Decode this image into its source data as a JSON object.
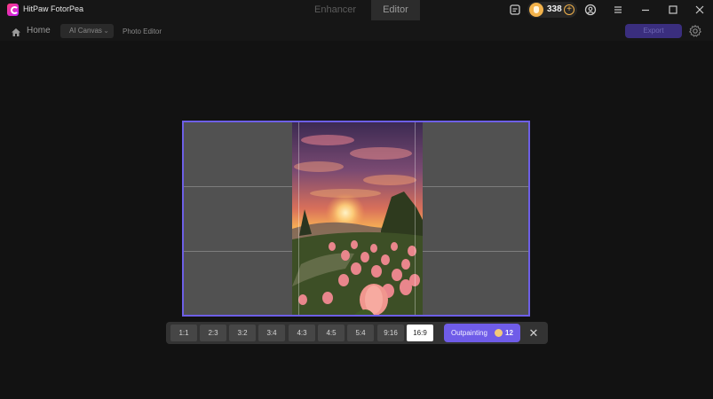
{
  "app": {
    "title": "HitPaw FotorPea"
  },
  "mode_tabs": [
    {
      "label": "Enhancer",
      "active": false
    },
    {
      "label": "Editor",
      "active": true
    }
  ],
  "titlebar": {
    "credits": "338",
    "icons": [
      "announcement-icon",
      "coin-icon",
      "add-credits-icon",
      "account-icon",
      "menu-icon",
      "minimize-icon",
      "maximize-icon",
      "close-icon"
    ]
  },
  "nav": {
    "home_label": "Home",
    "ai_canvas_label": "AI Canvas",
    "photo_editor_label": "Photo Editor",
    "export_label": "Export"
  },
  "ratio_bar": {
    "ratios": [
      "1:1",
      "2:3",
      "3:2",
      "3:4",
      "4:3",
      "4:5",
      "5:4",
      "9:16",
      "16:9"
    ],
    "selected": "16:9",
    "outpainting_label": "Outpainting",
    "outpainting_cost": "12"
  },
  "colors": {
    "accent": "#6f5ce8",
    "canvas_border": "#6d5fe6",
    "export_disabled": "#3a2e7e",
    "coin": "#f2b24b"
  }
}
